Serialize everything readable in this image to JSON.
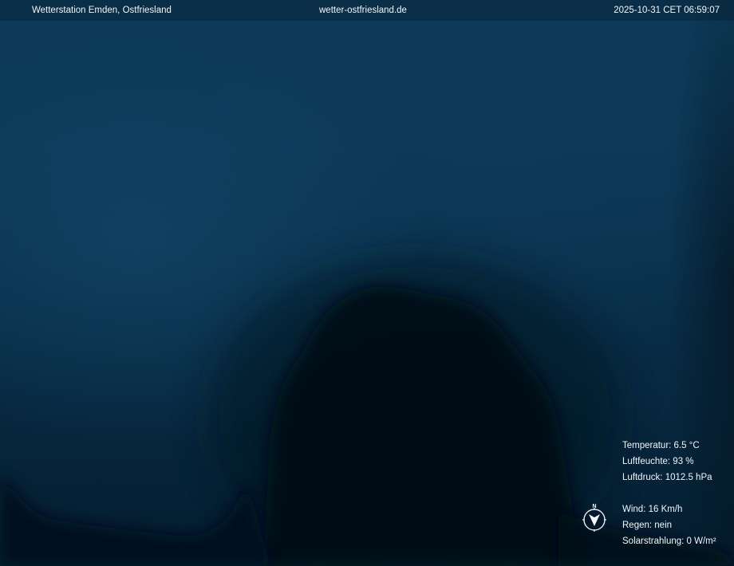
{
  "header": {
    "station_name": "Wetterstation Emden, Ostfriesland",
    "website": "wetter-ostfriesland.de",
    "timestamp": "2025-10-31 CET 06:59:07"
  },
  "readings": {
    "temperature": "Temperatur: 6.5 °C",
    "humidity": "Luftfeuchte: 93 %",
    "pressure": "Luftdruck: 1012.5 hPa",
    "wind": "Wind: 16 Km/h",
    "rain": "Regen: nein",
    "solar": "Solarstrahlung: 0 W/m²"
  },
  "compass": {
    "icon": "wind-direction-compass-icon",
    "north_label": "N"
  },
  "colors": {
    "sky_top": "#0c3a58",
    "sky_bottom": "#041d2f",
    "tree_silhouette": "#040e17",
    "overlay_text": "#f2f6fa"
  }
}
